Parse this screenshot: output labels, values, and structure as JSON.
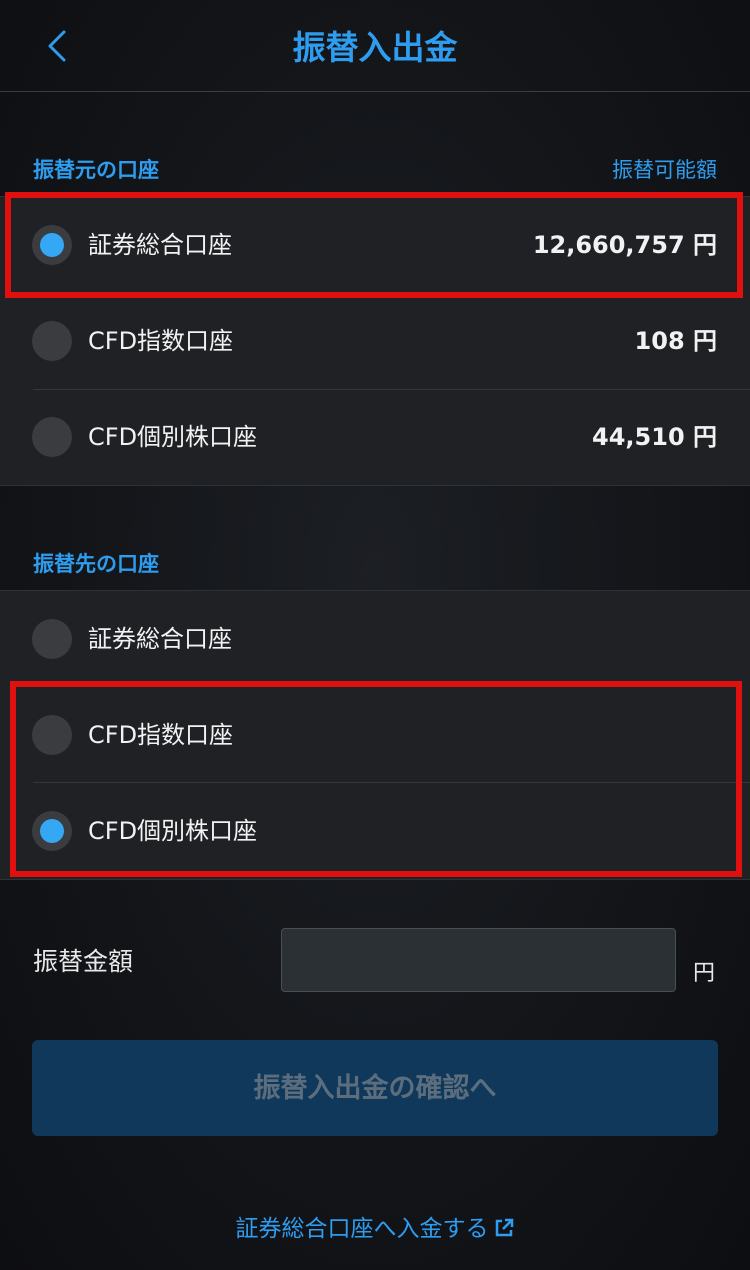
{
  "header": {
    "title": "振替入出金",
    "back_icon": "chevron-left-icon"
  },
  "source": {
    "heading": "振替元の口座",
    "right_label": "振替可能額",
    "accounts": [
      {
        "label": "証券総合口座",
        "value": "12,660,757 円",
        "selected": true
      },
      {
        "label": "CFD指数口座",
        "value": "108 円",
        "selected": false
      },
      {
        "label": "CFD個別株口座",
        "value": "44,510 円",
        "selected": false
      }
    ]
  },
  "destination": {
    "heading": "振替先の口座",
    "accounts": [
      {
        "label": "証券総合口座",
        "selected": false
      },
      {
        "label": "CFD指数口座",
        "selected": false
      },
      {
        "label": "CFD個別株口座",
        "selected": true
      }
    ]
  },
  "amount": {
    "label": "振替金額",
    "value": "",
    "placeholder": "",
    "unit": "円"
  },
  "confirm_button": {
    "label": "振替入出金の確認へ"
  },
  "deposit_link": {
    "label": "証券総合口座へ入金する",
    "icon": "external-link-icon"
  },
  "colors": {
    "accent": "#2e9df0",
    "radio_selected": "#35a8f5",
    "highlight": "#e0100f"
  }
}
